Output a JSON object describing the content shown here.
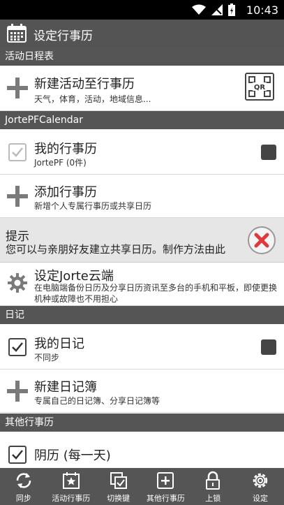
{
  "statusbar": {
    "time": "10:43"
  },
  "toolbar": {
    "title": "设定行事历"
  },
  "sections": {
    "events": "活动日程表",
    "jorte": "JortePFCalendar",
    "diary": "日记",
    "other": "其他行事历"
  },
  "new_event": {
    "title": "新建活动至行事历",
    "subtitle": "天气，体育，活动，地域信息...",
    "qr_label": "QR"
  },
  "my_calendar": {
    "title": "我的行事历",
    "subtitle": "JortePF (0件)"
  },
  "add_calendar": {
    "title": "添加行事历",
    "subtitle": "新增个人专属行事历或共享日历"
  },
  "hint": {
    "title": "提示",
    "text": "您可以与亲朋好友建立共享日历。制作方法由此"
  },
  "cloud": {
    "title": "设定Jorte云端",
    "subtitle": "在电脑端备份日历及分享日历资讯至多台的手机和平板，即使更换机种或故障也不用担心"
  },
  "my_diary": {
    "title": "我的日记",
    "subtitle": "不同步"
  },
  "new_diary": {
    "title": "新建日记簿",
    "subtitle": "专属自己的日记簿、分享日记簿等"
  },
  "lunar": {
    "title": "阴历 (每一天)"
  },
  "bottom_tabs": [
    "同步",
    "活动行事历",
    "切换键",
    "其他行事历",
    "上锁",
    "设定"
  ],
  "colors": {
    "header": "#555555",
    "statusbar": "#000000",
    "hint_bg": "#e6e6e6",
    "close_red": "#e0393b"
  }
}
